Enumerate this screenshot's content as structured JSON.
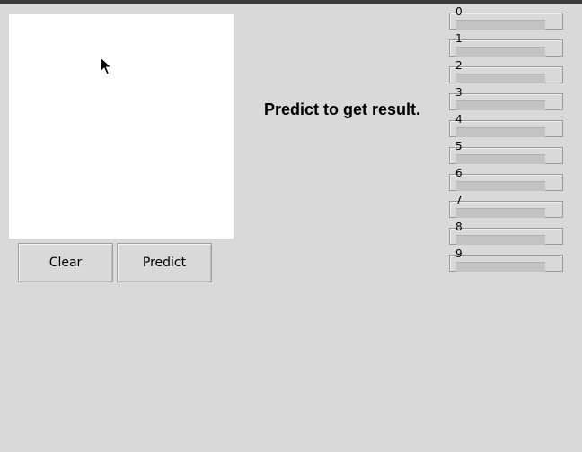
{
  "buttons": {
    "clear_label": "Clear",
    "predict_label": "Predict"
  },
  "result_text": "Predict to get result.",
  "probabilities": [
    {
      "label": "0",
      "value": 0
    },
    {
      "label": "1",
      "value": 0
    },
    {
      "label": "2",
      "value": 0
    },
    {
      "label": "3",
      "value": 0
    },
    {
      "label": "4",
      "value": 0
    },
    {
      "label": "5",
      "value": 0
    },
    {
      "label": "6",
      "value": 0
    },
    {
      "label": "7",
      "value": 0
    },
    {
      "label": "8",
      "value": 0
    },
    {
      "label": "9",
      "value": 0
    }
  ],
  "icons": {
    "cursor": "mouse-pointer-icon"
  },
  "colors": {
    "background": "#d9d9d9",
    "canvas": "#ffffff",
    "trough": "#c3c3c3"
  }
}
